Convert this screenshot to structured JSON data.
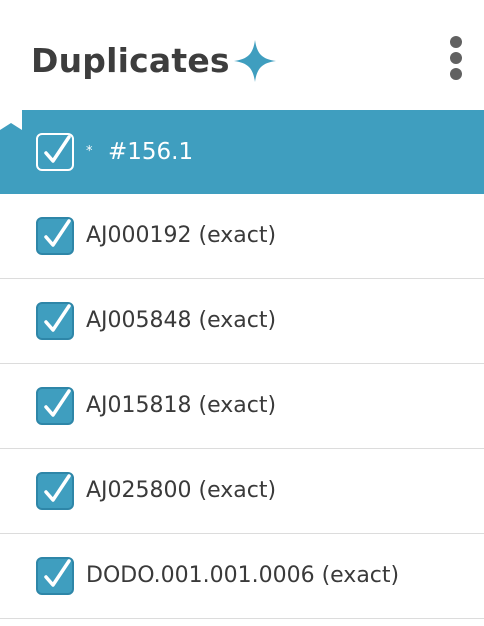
{
  "header": {
    "title": "Duplicates"
  },
  "items": [
    {
      "label": "#156.1",
      "marker": "*",
      "checked": true,
      "active": true
    },
    {
      "label": "AJ000192 (exact)",
      "checked": true,
      "active": false
    },
    {
      "label": "AJ005848 (exact)",
      "checked": true,
      "active": false
    },
    {
      "label": "AJ015818 (exact)",
      "checked": true,
      "active": false
    },
    {
      "label": "AJ025800 (exact)",
      "checked": true,
      "active": false
    },
    {
      "label": "DODO.001.001.0006 (exact)",
      "checked": true,
      "active": false
    }
  ],
  "icons": {
    "sparkle": "sparkle-icon",
    "menu": "kebab-menu-icon",
    "bookmark": "bookmark-icon",
    "check": "checkmark-icon"
  },
  "colors": {
    "accent": "#3f9ebf",
    "title": "#3d3d3d",
    "divider": "#dcdcdc"
  }
}
